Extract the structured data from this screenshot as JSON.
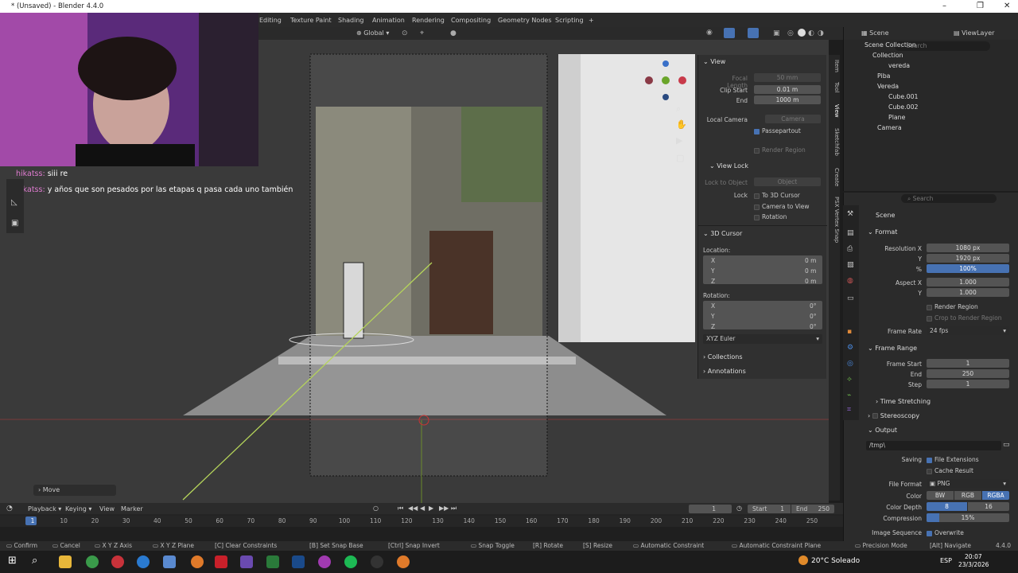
{
  "titlebar": {
    "title": "* (Unsaved) - Blender 4.4.0"
  },
  "workspaces": [
    "Editing",
    "Texture Paint",
    "Shading",
    "Animation",
    "Rendering",
    "Compositing",
    "Geometry Nodes",
    "Scripting"
  ],
  "header3d": {
    "orientation": "Global"
  },
  "chat": [
    {
      "user": "hikatss:",
      "text": "siii re"
    },
    {
      "user": "hikatss:",
      "text": "y años que son pesados por las etapas q pasa cada uno también"
    }
  ],
  "npanel": {
    "view_title": "View",
    "focal_label": "Focal Length",
    "focal_value": "50 mm",
    "clip_start_label": "Clip Start",
    "clip_start_value": "0.01 m",
    "end_label": "End",
    "end_value": "1000 m",
    "local_camera_label": "Local Camera",
    "camera_placeholder": "Camera",
    "passepartout": "Passepartout",
    "render_region": "Render Region",
    "viewlock_title": "View Lock",
    "lock_to_object": "Lock to Object",
    "object_placeholder": "Object",
    "lock_label": "Lock",
    "to_3d_cursor": "To 3D Cursor",
    "camera_to_view": "Camera to View",
    "rotation_check": "Rotation",
    "cursor_title": "3D Cursor",
    "location_label": "Location:",
    "loc": [
      {
        "axis": "X",
        "value": "0 m"
      },
      {
        "axis": "Y",
        "value": "0 m"
      },
      {
        "axis": "Z",
        "value": "0 m"
      }
    ],
    "rotation_label": "Rotation:",
    "rot": [
      {
        "axis": "X",
        "value": "0°"
      },
      {
        "axis": "Y",
        "value": "0°"
      },
      {
        "axis": "Z",
        "value": "0°"
      }
    ],
    "euler": "XYZ Euler",
    "collections": "Collections",
    "annotations": "Annotations",
    "tabs": [
      "Item",
      "Tool",
      "View",
      "Sketchfab",
      "Create",
      "PSX Vertex Snap"
    ]
  },
  "move_panel": "Move",
  "outliner": {
    "scene": "Scene",
    "viewlayer": "ViewLayer",
    "search": "Search",
    "rows": [
      {
        "label": "Scene Collection",
        "indent": 0
      },
      {
        "label": "Collection",
        "indent": 1
      },
      {
        "label": "vereda",
        "indent": 2
      },
      {
        "label": "Piba",
        "indent": 1
      },
      {
        "label": "Vereda",
        "indent": 1
      },
      {
        "label": "Cube.001",
        "indent": 2
      },
      {
        "label": "Cube.002",
        "indent": 2
      },
      {
        "label": "Plane",
        "indent": 2
      },
      {
        "label": "Camera",
        "indent": 1
      }
    ]
  },
  "properties": {
    "search": "Search",
    "scene": "Scene",
    "format_title": "Format",
    "resx_label": "Resolution X",
    "resx": "1080 px",
    "resy_label": "Y",
    "resy": "1920 px",
    "pct_label": "%",
    "pct": "100%",
    "aspx_label": "Aspect X",
    "aspx": "1.000",
    "aspy_label": "Y",
    "aspy": "1.000",
    "render_region": "Render Region",
    "crop": "Crop to Render Region",
    "fps_label": "Frame Rate",
    "fps": "24 fps",
    "frame_range_title": "Frame Range",
    "fstart_label": "Frame Start",
    "fstart": "1",
    "fend_label": "End",
    "fend": "250",
    "fstep_label": "Step",
    "fstep": "1",
    "time_stretching": "Time Stretching",
    "stereoscopy": "Stereoscopy",
    "output_title": "Output",
    "output_path": "/tmp\\",
    "saving_label": "Saving",
    "file_ext": "File Extensions",
    "cache_result": "Cache Result",
    "file_format_label": "File Format",
    "file_format": "PNG",
    "color_label": "Color",
    "color_opts": [
      "BW",
      "RGB",
      "RGBA"
    ],
    "depth_label": "Color Depth",
    "depth_opts": [
      "8",
      "16"
    ],
    "compression_label": "Compression",
    "compression": "15%",
    "imgseq_label": "Image Sequence",
    "overwrite": "Overwrite"
  },
  "timeline": {
    "playback": "Playback",
    "keying": "Keying",
    "view": "View",
    "marker": "Marker",
    "current": "1",
    "start_label": "Start",
    "start": "1",
    "end_label": "End",
    "end": "250",
    "ticks": [
      "1",
      "10",
      "20",
      "30",
      "40",
      "50",
      "60",
      "70",
      "80",
      "90",
      "100",
      "110",
      "120",
      "130",
      "140",
      "150",
      "160",
      "170",
      "180",
      "190",
      "200",
      "210",
      "220",
      "230",
      "240",
      "250"
    ]
  },
  "statusbar": {
    "items": [
      "Confirm",
      "Cancel",
      "X Y Z Axis",
      "X Y Z Plane",
      "Clear Constraints",
      "Set Snap Base",
      "Snap Invert",
      "Snap Toggle",
      "Rotate",
      "Resize",
      "Automatic Constraint",
      "Automatic Constraint Plane",
      "Precision Mode",
      "Navigate"
    ],
    "keys": [
      "",
      "",
      "",
      "",
      "C",
      "B",
      "Ctrl",
      "",
      "R",
      "S",
      "",
      "",
      "",
      "Alt"
    ],
    "version": "4.4.0"
  },
  "taskbar": {
    "weather": "20°C  Soleado",
    "lang": "ESP",
    "time": "20:07",
    "date": "23/3/2026"
  }
}
